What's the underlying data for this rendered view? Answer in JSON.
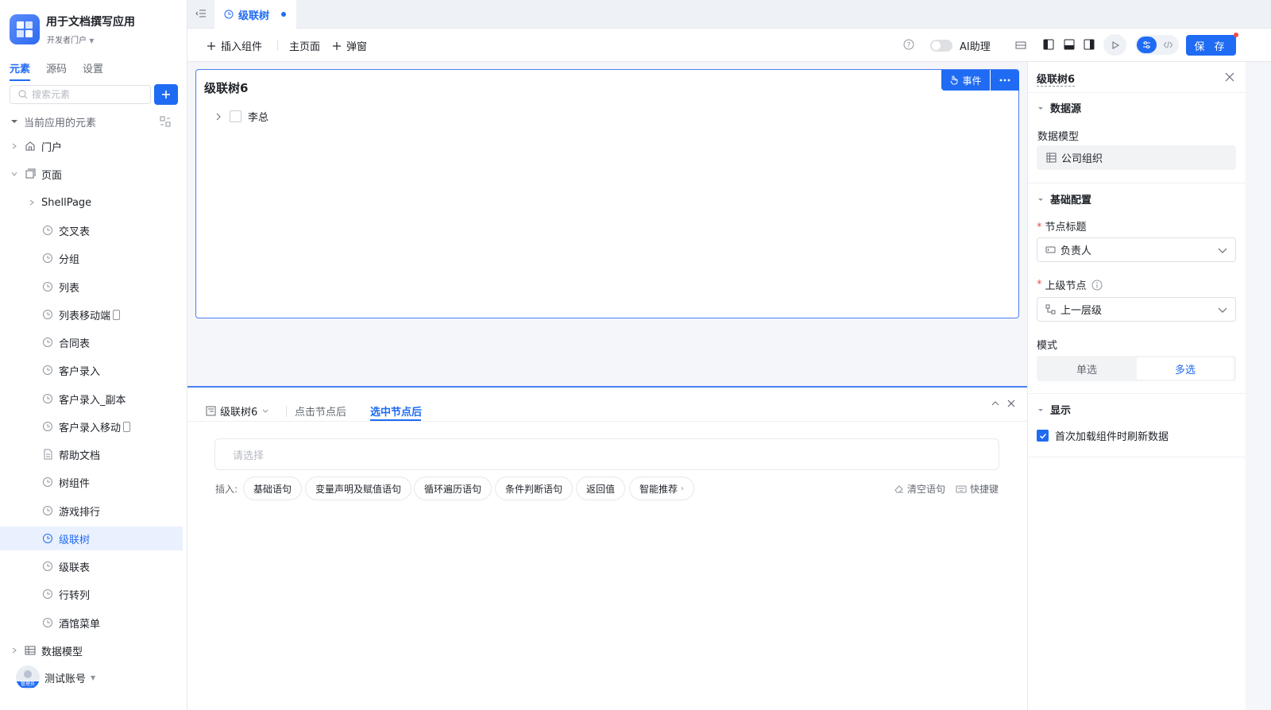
{
  "app": {
    "title": "用于文档撰写应用",
    "portal": "开发者门户"
  },
  "sidebar": {
    "tabs": [
      "元素",
      "源码",
      "设置"
    ],
    "search_placeholder": "搜索元素",
    "section_title": "当前应用的元素",
    "portal_item": "门户",
    "pages_item": "页面",
    "shell_page": "ShellPage",
    "pages": [
      "交叉表",
      "分组",
      "列表",
      "列表移动端",
      "合同表",
      "客户录入",
      "客户录入_副本",
      "客户录入移动",
      "帮助文档",
      "树组件",
      "游戏排行",
      "级联树",
      "级联表",
      "行转列",
      "酒馆菜单"
    ],
    "selected_page": "级联树",
    "data_model_item": "数据模型",
    "account": "测试账号",
    "avatar_label": "管理员"
  },
  "tabbar": {
    "active_tab": "级联树"
  },
  "toolbar": {
    "insert_component": "插入组件",
    "main_page": "主页面",
    "popup": "弹窗",
    "ai_label": "AI助理",
    "save_label": "保 存"
  },
  "canvas": {
    "card_title": "级联树6",
    "event_btn": "事件",
    "tree_node": "李总"
  },
  "bottom": {
    "component_tab": "级联树6",
    "tabs": [
      "点击节点后",
      "选中节点后"
    ],
    "active_tab": "选中节点后",
    "select_placeholder": "请选择",
    "insert_label": "插入:",
    "chips": [
      "基础语句",
      "变量声明及赋值语句",
      "循环遍历语句",
      "条件判断语句",
      "返回值",
      "智能推荐"
    ],
    "clear": "清空语句",
    "shortcut": "快捷键"
  },
  "right": {
    "title": "级联树6",
    "datasource_section": "数据源",
    "data_model_label": "数据模型",
    "data_model_value": "公司组织",
    "basic_section": "基础配置",
    "node_title_label": "节点标题",
    "node_title_value": "负责人",
    "parent_label": "上级节点",
    "parent_value": "上一层级",
    "mode_label": "模式",
    "mode_options": [
      "单选",
      "多选"
    ],
    "mode_selected": "多选",
    "display_section": "显示",
    "refresh_checkbox": "首次加载组件时刷新数据",
    "refresh_checked": true
  },
  "colors": {
    "accent": "#1f6bf3",
    "danger": "#f54a45",
    "text": "#1f2329",
    "muted": "#646a73"
  }
}
